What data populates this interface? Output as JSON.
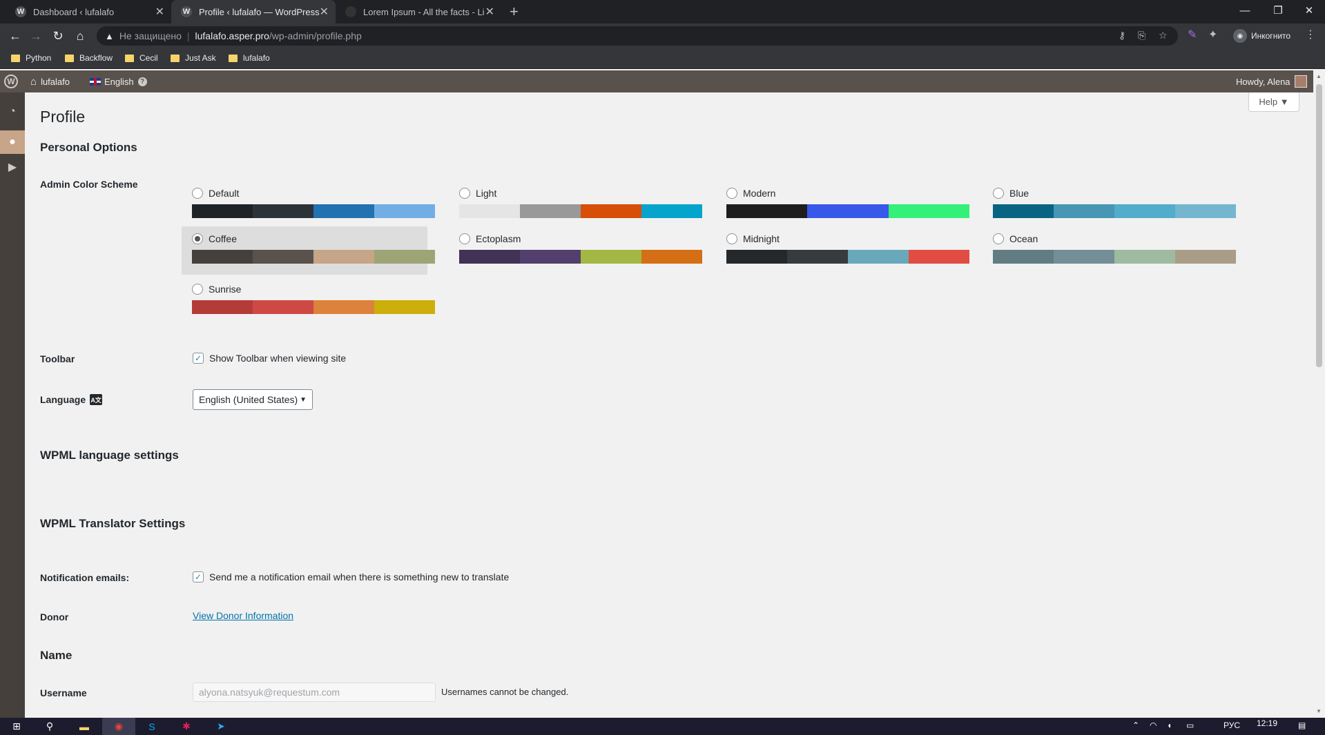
{
  "browser": {
    "tabs": [
      {
        "title": "Dashboard ‹ lufalafo",
        "active": false
      },
      {
        "title": "Profile ‹ lufalafo — WordPress",
        "active": true
      },
      {
        "title": "Lorem Ipsum - All the facts - Lip",
        "active": false
      }
    ],
    "new_tab": "+",
    "security_label": "Не защищено",
    "url_host": "lufalafo.asper.pro",
    "url_path": "/wp-admin/profile.php",
    "incognito_label": "Инкогнито",
    "bookmarks": [
      "Python",
      "Backflow",
      "Cecil",
      "Just Ask",
      "lufalafo"
    ]
  },
  "adminbar": {
    "site_name": "lufalafo",
    "language": "English",
    "greeting": "Howdy, Alena"
  },
  "page": {
    "title": "Profile",
    "help_label": "Help ▼",
    "personal_options_heading": "Personal Options",
    "color_scheme_label": "Admin Color Scheme",
    "color_schemes": [
      {
        "name": "Default",
        "colors": [
          "#1d2327",
          "#2c3338",
          "#2271b1",
          "#72aee6"
        ],
        "selected": false
      },
      {
        "name": "Light",
        "colors": [
          "#e5e5e5",
          "#999999",
          "#d64e07",
          "#04a4cc"
        ],
        "selected": false
      },
      {
        "name": "Modern",
        "colors": [
          "#1e1e1e",
          "#3858e9",
          "#33f078"
        ],
        "selected": false
      },
      {
        "name": "Blue",
        "colors": [
          "#096484",
          "#4796b3",
          "#52accc",
          "#74b6ce"
        ],
        "selected": false
      },
      {
        "name": "Coffee",
        "colors": [
          "#46403c",
          "#59524c",
          "#c7a589",
          "#9ea476"
        ],
        "selected": true
      },
      {
        "name": "Ectoplasm",
        "colors": [
          "#413256",
          "#523f6d",
          "#a3b745",
          "#d46f15"
        ],
        "selected": false
      },
      {
        "name": "Midnight",
        "colors": [
          "#25282b",
          "#363b3f",
          "#69a8bb",
          "#e14d43"
        ],
        "selected": false
      },
      {
        "name": "Ocean",
        "colors": [
          "#627c83",
          "#738e96",
          "#9ebaa0",
          "#aa9d88"
        ],
        "selected": false
      },
      {
        "name": "Sunrise",
        "colors": [
          "#b43c38",
          "#cf4944",
          "#dd823b",
          "#ccaf0b"
        ],
        "selected": false
      }
    ],
    "toolbar_label": "Toolbar",
    "toolbar_checkbox": "Show Toolbar when viewing site",
    "language_label": "Language",
    "language_value": "English (United States)",
    "wpml_language_heading": "WPML language settings",
    "wpml_translator_heading": "WPML Translator Settings",
    "notification_label": "Notification emails:",
    "notification_checkbox": "Send me a notification email when there is something new to translate",
    "donor_label": "Donor",
    "donor_link": "View Donor Information",
    "name_heading": "Name",
    "username_label": "Username",
    "username_value": "alyona.natsyuk@requestum.com",
    "username_note": "Usernames cannot be changed."
  },
  "taskbar": {
    "lang": "РУС",
    "time": "12:19"
  }
}
